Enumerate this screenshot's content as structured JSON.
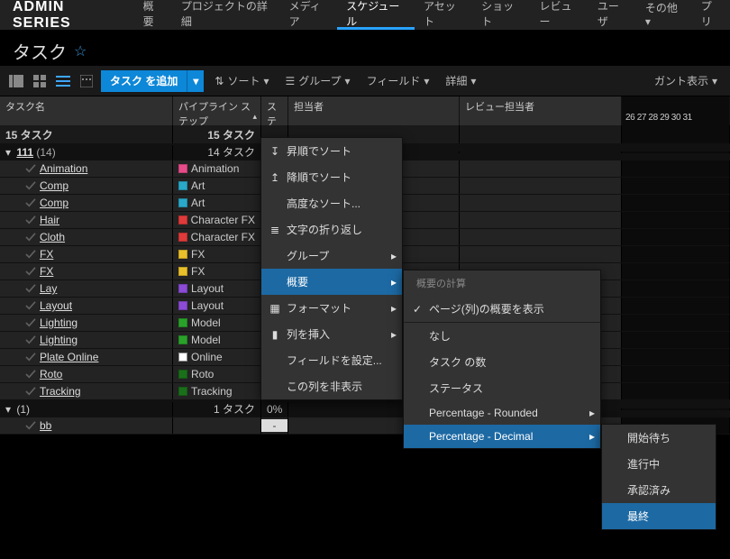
{
  "brand": "ADMIN SERIES",
  "nav": {
    "items": [
      "概要",
      "プロジェクトの詳細",
      "メディア",
      "スケジュール",
      "アセット",
      "ショット",
      "レビュー",
      "ユーザ",
      "その他 ▾",
      "プリ"
    ],
    "active_index": 3
  },
  "page": {
    "title": "タスク"
  },
  "toolbar": {
    "add_label": "タスク を追加",
    "sort": "ソート",
    "group": "グループ",
    "fields": "フィールド",
    "details": "詳細",
    "gantt_view": "ガント表示"
  },
  "columns": {
    "task": "タスク名",
    "pipeline": "パイプライン ステップ",
    "status": "ステータス",
    "assignee": "担当者",
    "reviewer": "レビュー担当者"
  },
  "gantt_ticks": "26 27 28 29 30 31",
  "summary": {
    "total": "15 タスク",
    "total2": "15 タスク"
  },
  "groups": [
    {
      "label": "111",
      "count_paren": "14",
      "right": "14 タスク",
      "rows": [
        {
          "task": "Animation",
          "pipe": "Animation",
          "sw": "c-pink"
        },
        {
          "task": "Comp",
          "pipe": "Art",
          "sw": "c-cyan"
        },
        {
          "task": "Comp",
          "pipe": "Art",
          "sw": "c-cyan"
        },
        {
          "task": "Hair",
          "pipe": "Character FX",
          "sw": "c-red"
        },
        {
          "task": "Cloth",
          "pipe": "Character FX",
          "sw": "c-red"
        },
        {
          "task": "FX",
          "pipe": "FX",
          "sw": "c-yellow"
        },
        {
          "task": "FX",
          "pipe": "FX",
          "sw": "c-yellow"
        },
        {
          "task": "Lay",
          "pipe": "Layout",
          "sw": "c-violet"
        },
        {
          "task": "Layout",
          "pipe": "Layout",
          "sw": "c-violet"
        },
        {
          "task": "Lighting",
          "pipe": "Model",
          "sw": "c-green"
        },
        {
          "task": "Lighting",
          "pipe": "Model",
          "sw": "c-green"
        },
        {
          "task": "Plate Online",
          "pipe": "Online",
          "sw": "c-white"
        },
        {
          "task": "Roto",
          "pipe": "Roto",
          "sw": "c-dgreen"
        },
        {
          "task": "Tracking",
          "pipe": "Tracking",
          "sw": "c-dgreen"
        }
      ]
    },
    {
      "label": "(1)",
      "right": "1 タスク",
      "pct": "0%",
      "rows": [
        {
          "task": "bb",
          "pipe": "",
          "status": "-"
        }
      ]
    }
  ],
  "menu1": {
    "items": [
      {
        "label": "昇順でソート",
        "pre": "↧"
      },
      {
        "label": "降順でソート",
        "pre": "↥"
      },
      {
        "label": "高度なソート..."
      },
      {
        "label": "文字の折り返し",
        "pre": "≣"
      },
      {
        "label": "グループ",
        "arrow": true
      },
      {
        "label": "概要",
        "arrow": true,
        "hl": true
      },
      {
        "label": "フォーマット",
        "pre": "▦",
        "arrow": true
      },
      {
        "label": "列を挿入",
        "pre": "▮",
        "arrow": true
      },
      {
        "label": "フィールドを設定..."
      },
      {
        "label": "この列を非表示"
      }
    ]
  },
  "menu2": {
    "header": "概要の計算",
    "items": [
      {
        "label": "ページ(列)の概要を表示",
        "pre": "✓"
      },
      {
        "label": "なし"
      },
      {
        "label": "タスク の数"
      },
      {
        "label": "ステータス"
      },
      {
        "label": "Percentage - Rounded",
        "arrow": true
      },
      {
        "label": "Percentage - Decimal",
        "arrow": true,
        "hl": true
      }
    ]
  },
  "menu3": {
    "items": [
      {
        "label": "開始待ち"
      },
      {
        "label": "進行中"
      },
      {
        "label": "承認済み"
      },
      {
        "label": "最終",
        "hl": true
      }
    ]
  }
}
